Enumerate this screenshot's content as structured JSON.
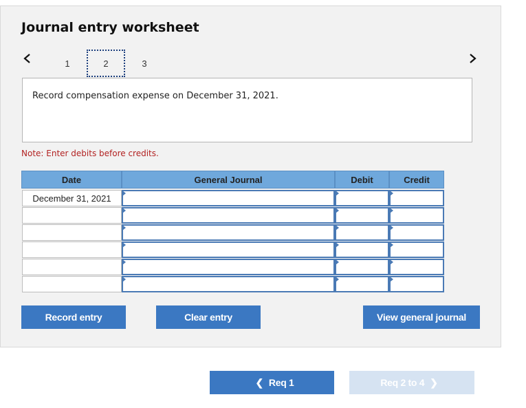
{
  "worksheet": {
    "title": "Journal entry worksheet",
    "pages": [
      "1",
      "2",
      "3"
    ],
    "active_page": "2",
    "prompt": "Record compensation expense on December 31, 2021.",
    "note": "Note: Enter debits before credits."
  },
  "table": {
    "headers": {
      "date": "Date",
      "journal": "General Journal",
      "debit": "Debit",
      "credit": "Credit"
    },
    "rows": [
      {
        "date": "December 31, 2021"
      },
      {
        "date": ""
      },
      {
        "date": ""
      },
      {
        "date": ""
      },
      {
        "date": ""
      },
      {
        "date": ""
      }
    ]
  },
  "buttons": {
    "record": "Record entry",
    "clear": "Clear entry",
    "view": "View general journal"
  },
  "footer_nav": {
    "prev_label": "Req 1",
    "next_label": "Req 2 to 4"
  },
  "colors": {
    "accent": "#3b78c2",
    "header_blue": "#6fa8dc",
    "note_red": "#b22222",
    "disabled": "#d6e3f2"
  },
  "icons": {
    "prev": "chevron-left-icon",
    "next": "chevron-right-icon"
  }
}
